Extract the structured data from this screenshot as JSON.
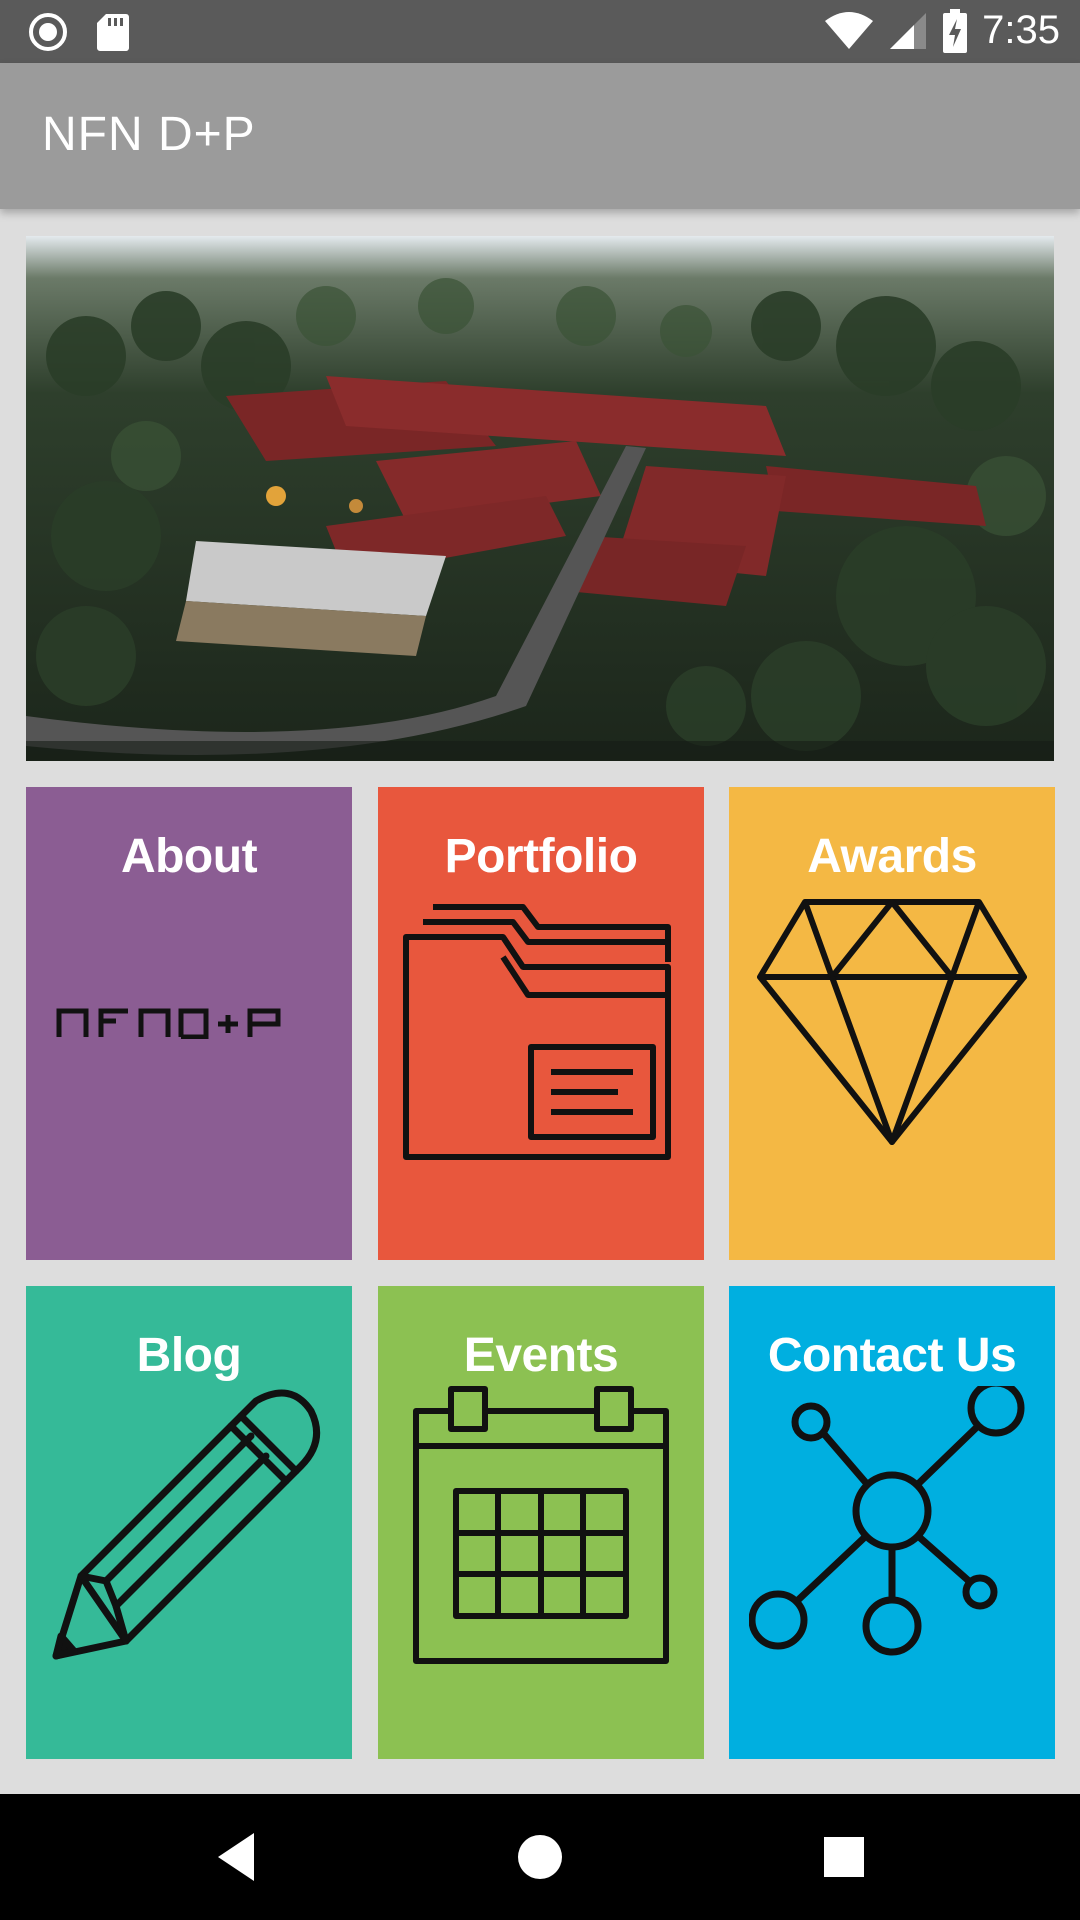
{
  "status_bar": {
    "time": "7:35",
    "left_icons": [
      "record-icon",
      "sd-card-icon"
    ],
    "right_icons": [
      "wifi-icon",
      "signal-icon",
      "battery-charging-icon"
    ]
  },
  "app_bar": {
    "title": "NFN D+P"
  },
  "tiles": [
    {
      "label": "About",
      "color": "#8b5d93",
      "icon": "nfn-dp-logo-icon",
      "logo_text": "NFN D+P"
    },
    {
      "label": "Portfolio",
      "color": "#e8573d",
      "icon": "folder-icon"
    },
    {
      "label": "Awards",
      "color": "#f4b844",
      "icon": "diamond-icon"
    },
    {
      "label": "Blog",
      "color": "#35ba98",
      "icon": "pencil-icon"
    },
    {
      "label": "Events",
      "color": "#8cc152",
      "icon": "calendar-icon"
    },
    {
      "label": "Contact Us",
      "color": "#00afe0",
      "icon": "network-icon"
    }
  ],
  "nav_bar": {
    "buttons": [
      "back-icon",
      "home-icon",
      "recents-icon"
    ]
  }
}
